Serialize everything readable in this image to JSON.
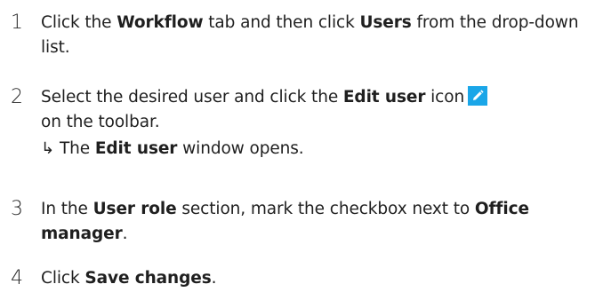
{
  "steps": [
    {
      "number": "1",
      "parts": [
        "Click the ",
        "Workflow",
        " tab and then click ",
        "Users",
        " from the drop-down list."
      ]
    },
    {
      "number": "2",
      "parts": [
        "Select the desired user and click the ",
        "Edit user",
        " icon",
        " on the toolbar."
      ],
      "icon": "pencil-edit-icon",
      "icon_color": "#1aa6e8",
      "result": {
        "arrow": "↳",
        "parts": [
          "The ",
          "Edit user",
          " window opens."
        ]
      }
    },
    {
      "number": "3",
      "parts": [
        "In the ",
        "User role",
        " section, mark the checkbox next to ",
        "Office manager",
        "."
      ]
    },
    {
      "number": "4",
      "parts": [
        "Click ",
        "Save changes",
        "."
      ]
    }
  ]
}
